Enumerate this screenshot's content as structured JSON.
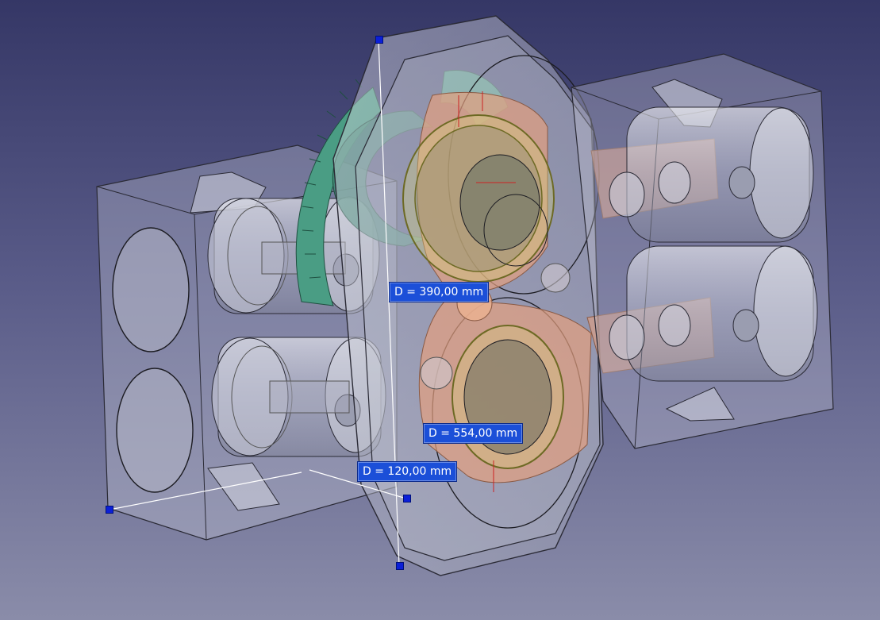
{
  "viewport": {
    "background_top": "#353766",
    "background_bottom": "#8a8ca9"
  },
  "dimensions": [
    {
      "id": "d1",
      "label": "D = 390,00 mm"
    },
    {
      "id": "d2",
      "label": "D = 554,00 mm"
    },
    {
      "id": "d3",
      "label": "D = 120,00 mm"
    }
  ],
  "colors": {
    "housing": "#c9cbd6",
    "gear": "#4a9d84",
    "rod": "#e4a07f",
    "bearing": "#d7d47a",
    "dimension_label": "#1b4fd8",
    "grip": "#0b1fd8"
  }
}
